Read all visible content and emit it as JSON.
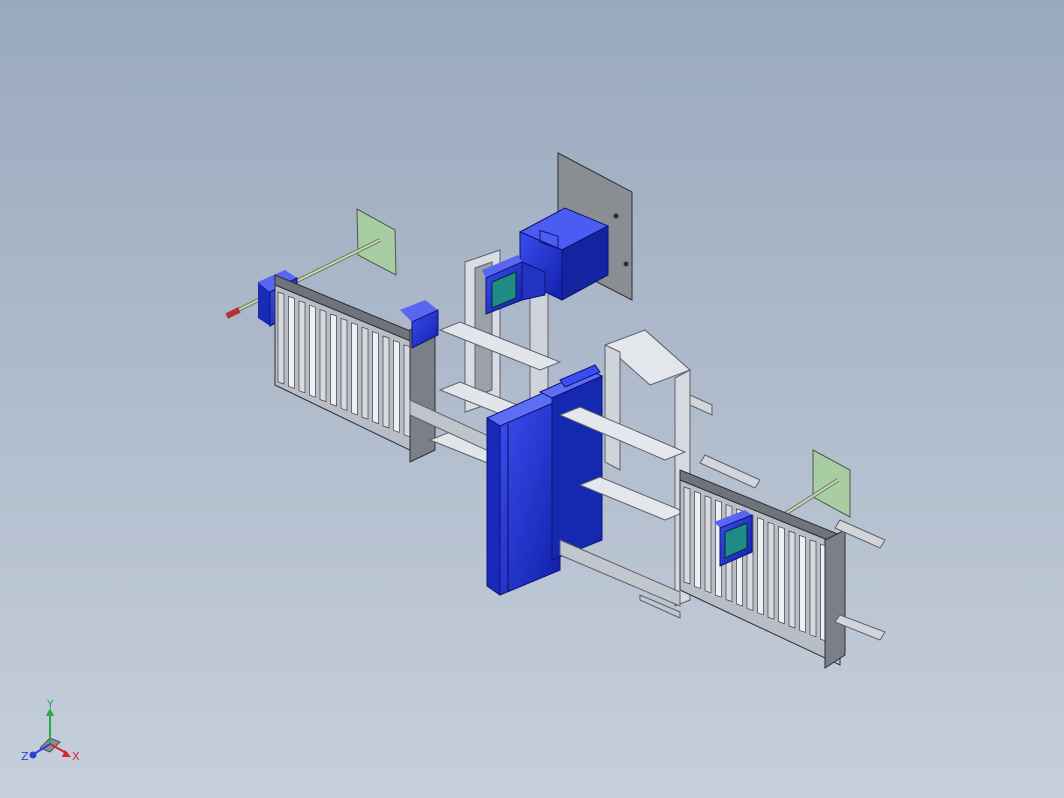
{
  "viewport": {
    "background_top": "#99a9bd",
    "background_bottom": "#c6cfdb",
    "model_accent": "#1c2fd6",
    "screen_color": "#1f8a86",
    "mount_plate_green": "#a9cda3",
    "frame_color": "#c9cdd4"
  },
  "triad": {
    "x_label": "X",
    "y_label": "Y",
    "z_label": "Z",
    "x_color": "#d8262a",
    "y_color": "#2aa84a",
    "z_color": "#2c3fd8"
  }
}
